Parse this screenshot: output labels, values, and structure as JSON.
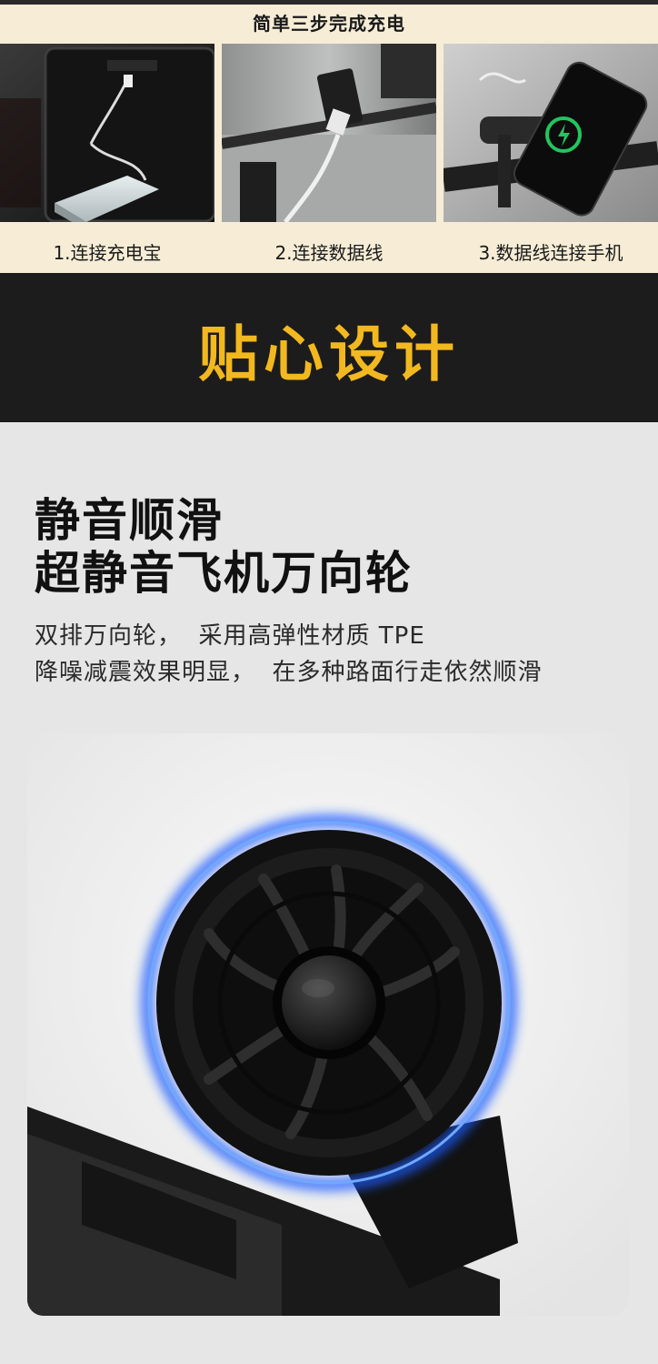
{
  "charging": {
    "title": "简单三步完成充电",
    "steps": [
      {
        "label": "1.连接充电宝",
        "image": "suitcase-interior-power-bank"
      },
      {
        "label": "2.连接数据线",
        "image": "suitcase-usb-port-cable"
      },
      {
        "label": "3.数据线连接手机",
        "image": "phone-charging-on-handle"
      }
    ],
    "charging_icon": "battery-bolt-icon",
    "accent": "#f7edd6"
  },
  "design": {
    "banner_title": "贴心设计",
    "banner_color": "#f2b81f"
  },
  "wheel": {
    "headline_1": "静音顺滑",
    "headline_2": "超静音飞机万向轮",
    "desc_1": "双排万向轮，  采用高弹性材质 TPE",
    "desc_2": "降噪减震效果明显，  在多种路面行走依然顺滑",
    "image": "spinner-wheel-with-blue-glow",
    "glow_color": "#2a6bff"
  }
}
